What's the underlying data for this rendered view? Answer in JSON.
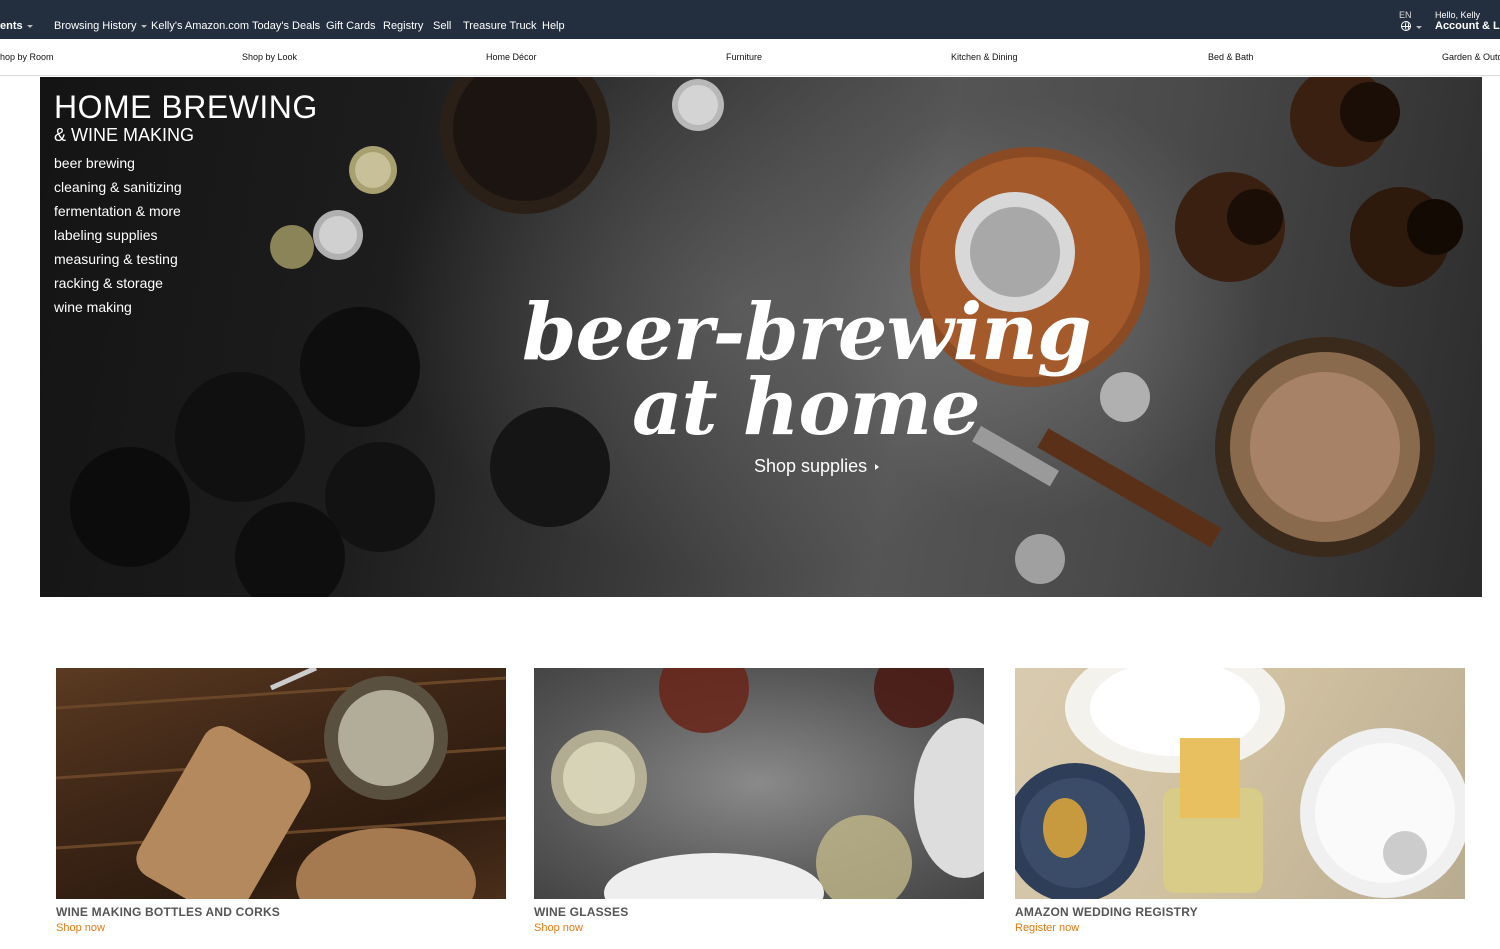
{
  "topnav": {
    "items": [
      {
        "label": "ents",
        "bold": true,
        "caret": true
      },
      {
        "label": "Browsing History",
        "caret": true
      },
      {
        "label": "Kelly's Amazon.com"
      },
      {
        "label": "Today's Deals"
      },
      {
        "label": "Gift Cards"
      },
      {
        "label": "Registry"
      },
      {
        "label": "Sell"
      },
      {
        "label": "Treasure Truck"
      },
      {
        "label": "Help"
      }
    ],
    "language": "EN",
    "hello": "Hello, Kelly",
    "account": "Account & Li"
  },
  "subnav": {
    "items": [
      "hop by Room",
      "Shop by Look",
      "Home Décor",
      "Furniture",
      "Kitchen & Dining",
      "Bed & Bath",
      "Garden & Outd"
    ]
  },
  "hero": {
    "title": "HOME BREWING",
    "subtitle": "& WINE MAKING",
    "links": [
      "beer brewing",
      "cleaning & sanitizing",
      "fermentation & more",
      "labeling supplies",
      "measuring & testing",
      "racking & storage",
      "wine making"
    ],
    "script_line1": "beer-brewing",
    "script_line2": "at home",
    "cta": "Shop supplies"
  },
  "tiles": [
    {
      "title": "WINE MAKING BOTTLES AND CORKS",
      "link": "Shop now"
    },
    {
      "title": "WINE GLASSES",
      "link": "Shop now"
    },
    {
      "title": "AMAZON WEDDING REGISTRY",
      "link": "Register now"
    }
  ],
  "colors": {
    "nav_bg": "#232f3e",
    "link_orange": "#e47911",
    "tile_title": "#555555"
  }
}
